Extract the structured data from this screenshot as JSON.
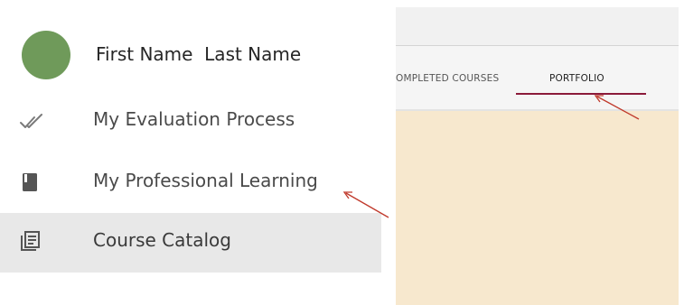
{
  "sidebar": {
    "user_name": "First Name  Last Name",
    "avatar_color": "#6f9a5a",
    "items": [
      {
        "label": "My Evaluation Process",
        "icon": "double-check-icon"
      },
      {
        "label": "My Professional Learning",
        "icon": "book-icon"
      },
      {
        "label": "Course Catalog",
        "icon": "catalog-list-icon",
        "active": true
      }
    ]
  },
  "app": {
    "tabs": [
      {
        "label": "OMPLETED COURSES"
      },
      {
        "label": "PORTFOLIO",
        "active": true
      }
    ],
    "accent_color": "#8b1a3a",
    "content_background": "#f7e8ce"
  },
  "annotations": {
    "arrow_color": "#c0392b"
  }
}
